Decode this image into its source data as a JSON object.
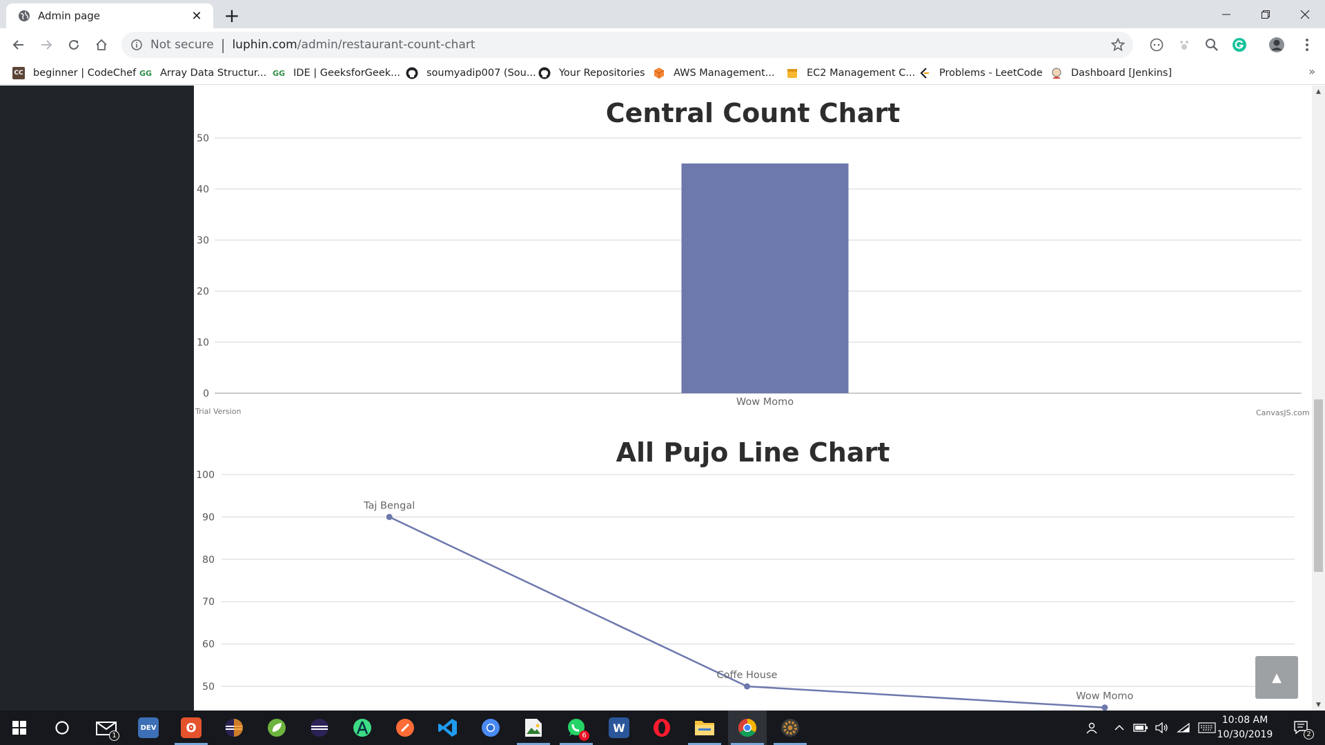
{
  "browser": {
    "tab": {
      "title": "Admin page"
    },
    "address_bar": {
      "security_label": "Not secure",
      "separator": "|",
      "url_host": "luphin.com",
      "url_path": "/admin/restaurant-count-chart"
    },
    "bookmarks": [
      {
        "label": "beginner | CodeChef",
        "icon": "codechef-icon",
        "icon_text": "CC",
        "color": "#5b4638"
      },
      {
        "label": "Array Data Structur...",
        "icon": "geeksforgeeks-icon",
        "icon_text": "GG",
        "color": "#2f8d46"
      },
      {
        "label": "IDE | GeeksforGeek...",
        "icon": "geeksforgeeks-icon",
        "icon_text": "GG",
        "color": "#2f8d46"
      },
      {
        "label": "soumyadip007 (Sou...",
        "icon": "github-icon",
        "icon_text": "",
        "color": "#202124"
      },
      {
        "label": "Your Repositories",
        "icon": "github-icon",
        "icon_text": "",
        "color": "#202124"
      },
      {
        "label": "AWS Management...",
        "icon": "aws-cube-icon",
        "icon_text": "",
        "color": "#f58536"
      },
      {
        "label": "EC2 Management C...",
        "icon": "aws-box-icon",
        "icon_text": "",
        "color": "#f7b72f"
      },
      {
        "label": "Problems - LeetCode",
        "icon": "leetcode-icon",
        "icon_text": "",
        "color": "#f89f1b"
      },
      {
        "label": "Dashboard [Jenkins]",
        "icon": "jenkins-icon",
        "icon_text": "",
        "color": "#d24939"
      }
    ],
    "bookmarks_overflow": "»"
  },
  "page": {
    "bar_chart": {
      "credit_left": "Trial Version",
      "credit_right": "CanvasJS.com"
    },
    "scroll_top_glyph": "▲"
  },
  "chart_data": [
    {
      "type": "bar",
      "title": "Central Count Chart",
      "categories": [
        "Wow Momo"
      ],
      "values": [
        45
      ],
      "ylim": [
        0,
        50
      ],
      "yticks": [
        0,
        10,
        20,
        30,
        40,
        50
      ],
      "xlabel": "",
      "ylabel": "",
      "grid": true,
      "color": "#6d78ad"
    },
    {
      "type": "line",
      "title": "All Pujo Line Chart",
      "categories": [
        "Taj Bengal",
        "Coffe House",
        "Wow Momo"
      ],
      "values": [
        90,
        50,
        45
      ],
      "ylim": [
        50,
        100
      ],
      "yticks": [
        50,
        60,
        70,
        80,
        90,
        100
      ],
      "xlabel": "",
      "ylabel": "",
      "grid": true,
      "color": "#6d78ad"
    }
  ],
  "taskbar": {
    "items": [
      {
        "name": "start-button",
        "icon": "windows-logo-icon"
      },
      {
        "name": "search-button",
        "icon": "cortana-circle-icon"
      },
      {
        "name": "mail-app",
        "icon": "mail-icon",
        "badge": "1"
      },
      {
        "name": "dev-app",
        "icon": "dev-icon",
        "text": "DEV",
        "color": "#3d6fb6"
      },
      {
        "name": "app-orange",
        "icon": "bracket-app-icon",
        "text": "ʘ",
        "color": "#e5532d"
      },
      {
        "name": "eclipse-app",
        "icon": "eclipse-icon",
        "color": "#2c2255"
      },
      {
        "name": "spring-app",
        "icon": "spring-leaf-icon",
        "color": "#6db33f"
      },
      {
        "name": "eclipse-app-2",
        "icon": "eclipse-icon",
        "color": "#2c2255"
      },
      {
        "name": "android-studio-app",
        "icon": "android-studio-icon",
        "color": "#3ddc84"
      },
      {
        "name": "postman-app",
        "icon": "postman-icon",
        "color": "#ff6c37"
      },
      {
        "name": "vscode-app",
        "icon": "vscode-icon",
        "color": "#1f9cf0"
      },
      {
        "name": "chromium-app",
        "icon": "chromium-icon",
        "color": "#4a8af4"
      },
      {
        "name": "image-editor-app",
        "icon": "image-file-icon",
        "color": "#2e7d32"
      },
      {
        "name": "whatsapp-app",
        "icon": "whatsapp-icon",
        "color": "#25d366",
        "badge": "6"
      },
      {
        "name": "word-app",
        "icon": "word-icon",
        "text": "W",
        "color": "#2b579a"
      },
      {
        "name": "opera-app",
        "icon": "opera-icon",
        "text": "O",
        "color": "#ff1b2d"
      },
      {
        "name": "file-explorer-app",
        "icon": "folder-icon",
        "color": "#f8c33a"
      },
      {
        "name": "chrome-app",
        "icon": "chrome-icon",
        "color": "#db4437"
      },
      {
        "name": "settings-app",
        "icon": "gear-icon",
        "color": "#3a3a3a"
      }
    ],
    "clock": {
      "time": "10:08 AM",
      "date": "10/30/2019"
    },
    "notification_badge": "2"
  }
}
